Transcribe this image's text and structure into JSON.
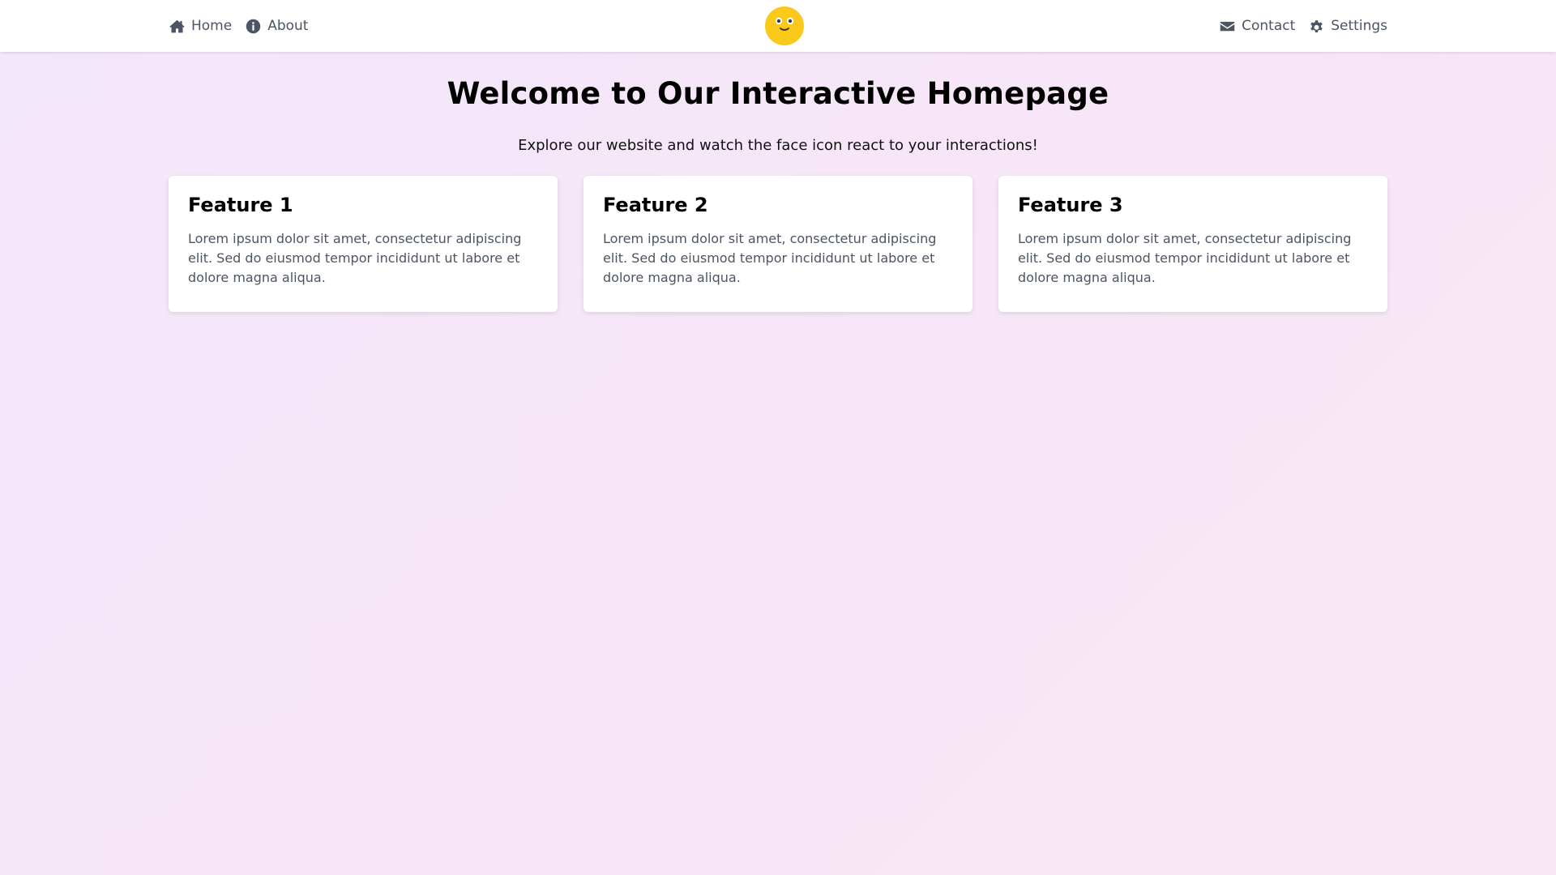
{
  "nav": {
    "left": [
      {
        "label": "Home",
        "icon": "home-icon"
      },
      {
        "label": "About",
        "icon": "info-icon"
      }
    ],
    "right": [
      {
        "label": "Contact",
        "icon": "envelope-icon"
      },
      {
        "label": "Settings",
        "icon": "gear-icon"
      }
    ],
    "center_icon": "face-icon"
  },
  "hero": {
    "title": "Welcome to Our Interactive Homepage",
    "subtitle": "Explore our website and watch the face icon react to your interactions!"
  },
  "features": [
    {
      "title": "Feature 1",
      "text": "Lorem ipsum dolor sit amet, consectetur adipiscing elit. Sed do eiusmod tempor incididunt ut labore et dolore magna aliqua."
    },
    {
      "title": "Feature 2",
      "text": "Lorem ipsum dolor sit amet, consectetur adipiscing elit. Sed do eiusmod tempor incididunt ut labore et dolore magna aliqua."
    },
    {
      "title": "Feature 3",
      "text": "Lorem ipsum dolor sit amet, consectetur adipiscing elit. Sed do eiusmod tempor incididunt ut labore et dolore magna aliqua."
    }
  ],
  "colors": {
    "face": "#fbc91b",
    "nav_text": "#4b5563",
    "card_bg": "#ffffff",
    "background": "#f5e6f8"
  }
}
